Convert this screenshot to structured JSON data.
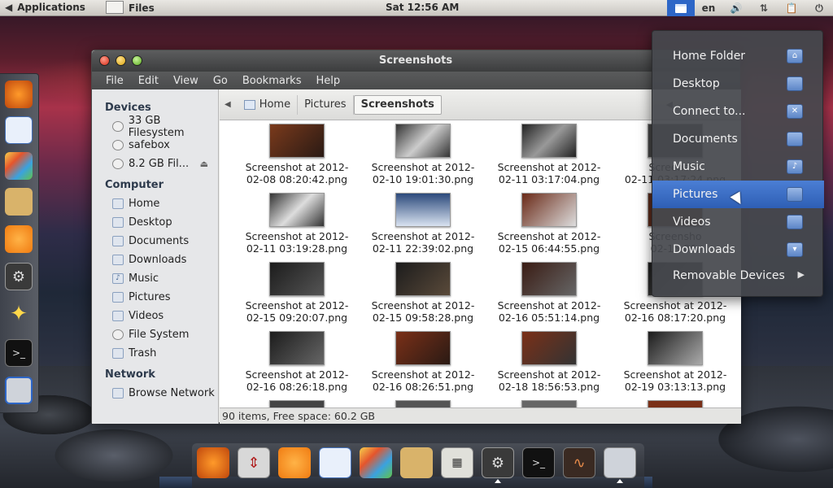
{
  "top_panel": {
    "applications_label": "Applications",
    "files_label": "Files",
    "clock": "Sat 12:56 AM",
    "lang": "en"
  },
  "window": {
    "title": "Screenshots",
    "menu": [
      "File",
      "Edit",
      "View",
      "Go",
      "Bookmarks",
      "Help"
    ],
    "sidebar": {
      "devices_head": "Devices",
      "devices": [
        "33 GB Filesystem",
        "safebox",
        "8.2 GB Fil..."
      ],
      "computer_head": "Computer",
      "computer": [
        "Home",
        "Desktop",
        "Documents",
        "Downloads",
        "Music",
        "Pictures",
        "Videos",
        "File System",
        "Trash"
      ],
      "network_head": "Network",
      "network": [
        "Browse Network"
      ]
    },
    "pathbar": [
      "Home",
      "Pictures",
      "Screenshots"
    ],
    "files": [
      [
        "Screenshot at 2012-",
        "02-08 08:20:42.png"
      ],
      [
        "Screenshot at 2012-",
        "02-10 19:01:30.png"
      ],
      [
        "Screenshot at 2012-",
        "02-11 03:17:04.png"
      ],
      [
        "Screensho",
        "02-11 03:17:24.png"
      ],
      [
        "Screenshot at 2012-",
        "02-11 03:19:28.png"
      ],
      [
        "Screenshot at 2012-",
        "02-11 22:39:02.png"
      ],
      [
        "Screenshot at 2012-",
        "02-15 06:44:55.png"
      ],
      [
        "Screensho",
        "02-15 06:"
      ],
      [
        "Screenshot at 2012-",
        "02-15 09:20:07.png"
      ],
      [
        "Screenshot at 2012-",
        "02-15 09:58:28.png"
      ],
      [
        "Screenshot at 2012-",
        "02-16 05:51:14.png"
      ],
      [
        "Screenshot at 2012-",
        "02-16 08:17:20.png"
      ],
      [
        "Screenshot at 2012-",
        "02-16 08:26:18.png"
      ],
      [
        "Screenshot at 2012-",
        "02-16 08:26:51.png"
      ],
      [
        "Screenshot at 2012-",
        "02-18 18:56:53.png"
      ],
      [
        "Screenshot at 2012-",
        "02-19 03:13:13.png"
      ]
    ],
    "status": "90 items, Free space: 60.2 GB"
  },
  "places_menu": {
    "items": [
      "Home Folder",
      "Desktop",
      "Connect to...",
      "Documents",
      "Music",
      "Pictures",
      "Videos",
      "Downloads",
      "Removable Devices"
    ],
    "highlighted": "Pictures"
  },
  "colors": {
    "accent": "#2e5fb5",
    "panel": "#c9c6c0"
  }
}
